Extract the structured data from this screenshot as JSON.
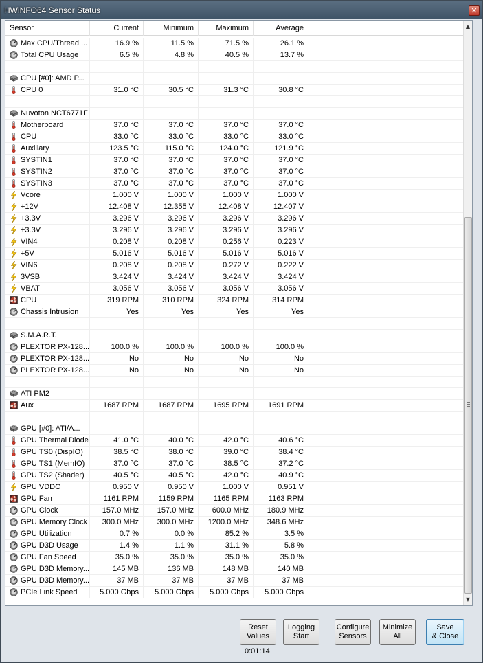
{
  "window": {
    "title": "HWiNFO64 Sensor Status",
    "close": "✕"
  },
  "columns": {
    "sensor": "Sensor",
    "current": "Current",
    "minimum": "Minimum",
    "maximum": "Maximum",
    "average": "Average"
  },
  "rows": [
    {
      "icon": "gauge",
      "name": "Max CPU/Thread ...",
      "cur": "16.9 %",
      "min": "11.5 %",
      "max": "71.5 %",
      "avg": "26.1 %"
    },
    {
      "icon": "gauge",
      "name": "Total CPU Usage",
      "cur": "6.5 %",
      "min": "4.8 %",
      "max": "40.5 %",
      "avg": "13.7 %"
    },
    {
      "icon": "",
      "name": "",
      "cur": "",
      "min": "",
      "max": "",
      "avg": ""
    },
    {
      "icon": "chip",
      "name": "CPU [#0]: AMD P...",
      "cur": "",
      "min": "",
      "max": "",
      "avg": ""
    },
    {
      "icon": "therm",
      "name": "CPU 0",
      "cur": "31.0 °C",
      "min": "30.5 °C",
      "max": "31.3 °C",
      "avg": "30.8 °C"
    },
    {
      "icon": "",
      "name": "",
      "cur": "",
      "min": "",
      "max": "",
      "avg": ""
    },
    {
      "icon": "chip",
      "name": "Nuvoton NCT6771F",
      "cur": "",
      "min": "",
      "max": "",
      "avg": ""
    },
    {
      "icon": "therm",
      "name": "Motherboard",
      "cur": "37.0 °C",
      "min": "37.0 °C",
      "max": "37.0 °C",
      "avg": "37.0 °C"
    },
    {
      "icon": "therm",
      "name": "CPU",
      "cur": "33.0 °C",
      "min": "33.0 °C",
      "max": "33.0 °C",
      "avg": "33.0 °C"
    },
    {
      "icon": "therm",
      "name": "Auxiliary",
      "cur": "123.5 °C",
      "min": "115.0 °C",
      "max": "124.0 °C",
      "avg": "121.9 °C"
    },
    {
      "icon": "therm",
      "name": "SYSTIN1",
      "cur": "37.0 °C",
      "min": "37.0 °C",
      "max": "37.0 °C",
      "avg": "37.0 °C"
    },
    {
      "icon": "therm",
      "name": "SYSTIN2",
      "cur": "37.0 °C",
      "min": "37.0 °C",
      "max": "37.0 °C",
      "avg": "37.0 °C"
    },
    {
      "icon": "therm",
      "name": "SYSTIN3",
      "cur": "37.0 °C",
      "min": "37.0 °C",
      "max": "37.0 °C",
      "avg": "37.0 °C"
    },
    {
      "icon": "bolt",
      "name": "Vcore",
      "cur": "1.000 V",
      "min": "1.000 V",
      "max": "1.000 V",
      "avg": "1.000 V"
    },
    {
      "icon": "bolt",
      "name": "+12V",
      "cur": "12.408 V",
      "min": "12.355 V",
      "max": "12.408 V",
      "avg": "12.407 V"
    },
    {
      "icon": "bolt",
      "name": "+3.3V",
      "cur": "3.296 V",
      "min": "3.296 V",
      "max": "3.296 V",
      "avg": "3.296 V"
    },
    {
      "icon": "bolt",
      "name": "+3.3V",
      "cur": "3.296 V",
      "min": "3.296 V",
      "max": "3.296 V",
      "avg": "3.296 V"
    },
    {
      "icon": "bolt",
      "name": "VIN4",
      "cur": "0.208 V",
      "min": "0.208 V",
      "max": "0.256 V",
      "avg": "0.223 V"
    },
    {
      "icon": "bolt",
      "name": "+5V",
      "cur": "5.016 V",
      "min": "5.016 V",
      "max": "5.016 V",
      "avg": "5.016 V"
    },
    {
      "icon": "bolt",
      "name": "VIN6",
      "cur": "0.208 V",
      "min": "0.208 V",
      "max": "0.272 V",
      "avg": "0.222 V"
    },
    {
      "icon": "bolt",
      "name": "3VSB",
      "cur": "3.424 V",
      "min": "3.424 V",
      "max": "3.424 V",
      "avg": "3.424 V"
    },
    {
      "icon": "bolt",
      "name": "VBAT",
      "cur": "3.056 V",
      "min": "3.056 V",
      "max": "3.056 V",
      "avg": "3.056 V"
    },
    {
      "icon": "fan",
      "name": "CPU",
      "cur": "319 RPM",
      "min": "310 RPM",
      "max": "324 RPM",
      "avg": "314 RPM"
    },
    {
      "icon": "gauge",
      "name": "Chassis Intrusion",
      "cur": "Yes",
      "min": "Yes",
      "max": "Yes",
      "avg": "Yes"
    },
    {
      "icon": "",
      "name": "",
      "cur": "",
      "min": "",
      "max": "",
      "avg": ""
    },
    {
      "icon": "chip",
      "name": "S.M.A.R.T.",
      "cur": "",
      "min": "",
      "max": "",
      "avg": ""
    },
    {
      "icon": "gauge",
      "name": "PLEXTOR PX-128...",
      "cur": "100.0 %",
      "min": "100.0 %",
      "max": "100.0 %",
      "avg": "100.0 %"
    },
    {
      "icon": "gauge",
      "name": "PLEXTOR PX-128...",
      "cur": "No",
      "min": "No",
      "max": "No",
      "avg": "No"
    },
    {
      "icon": "gauge",
      "name": "PLEXTOR PX-128...",
      "cur": "No",
      "min": "No",
      "max": "No",
      "avg": "No"
    },
    {
      "icon": "",
      "name": "",
      "cur": "",
      "min": "",
      "max": "",
      "avg": ""
    },
    {
      "icon": "chip",
      "name": "ATI PM2",
      "cur": "",
      "min": "",
      "max": "",
      "avg": ""
    },
    {
      "icon": "fan",
      "name": "Aux",
      "cur": "1687 RPM",
      "min": "1687 RPM",
      "max": "1695 RPM",
      "avg": "1691 RPM"
    },
    {
      "icon": "",
      "name": "",
      "cur": "",
      "min": "",
      "max": "",
      "avg": ""
    },
    {
      "icon": "chip",
      "name": "GPU [#0]: ATI/A...",
      "cur": "",
      "min": "",
      "max": "",
      "avg": ""
    },
    {
      "icon": "therm",
      "name": "GPU Thermal Diode",
      "cur": "41.0 °C",
      "min": "40.0 °C",
      "max": "42.0 °C",
      "avg": "40.6 °C"
    },
    {
      "icon": "therm",
      "name": "GPU TS0 (DispIO)",
      "cur": "38.5 °C",
      "min": "38.0 °C",
      "max": "39.0 °C",
      "avg": "38.4 °C"
    },
    {
      "icon": "therm",
      "name": "GPU TS1 (MemIO)",
      "cur": "37.0 °C",
      "min": "37.0 °C",
      "max": "38.5 °C",
      "avg": "37.2 °C"
    },
    {
      "icon": "therm",
      "name": "GPU TS2 (Shader)",
      "cur": "40.5 °C",
      "min": "40.5 °C",
      "max": "42.0 °C",
      "avg": "40.9 °C"
    },
    {
      "icon": "bolt",
      "name": "GPU VDDC",
      "cur": "0.950 V",
      "min": "0.950 V",
      "max": "1.000 V",
      "avg": "0.951 V"
    },
    {
      "icon": "fan",
      "name": "GPU Fan",
      "cur": "1161 RPM",
      "min": "1159 RPM",
      "max": "1165 RPM",
      "avg": "1163 RPM"
    },
    {
      "icon": "gauge",
      "name": "GPU Clock",
      "cur": "157.0 MHz",
      "min": "157.0 MHz",
      "max": "600.0 MHz",
      "avg": "180.9 MHz"
    },
    {
      "icon": "gauge",
      "name": "GPU Memory Clock",
      "cur": "300.0 MHz",
      "min": "300.0 MHz",
      "max": "1200.0 MHz",
      "avg": "348.6 MHz"
    },
    {
      "icon": "gauge",
      "name": "GPU Utilization",
      "cur": "0.7 %",
      "min": "0.0 %",
      "max": "85.2 %",
      "avg": "3.5 %"
    },
    {
      "icon": "gauge",
      "name": "GPU D3D Usage",
      "cur": "1.4 %",
      "min": "1.1 %",
      "max": "31.1 %",
      "avg": "5.8 %"
    },
    {
      "icon": "gauge",
      "name": "GPU Fan Speed",
      "cur": "35.0 %",
      "min": "35.0 %",
      "max": "35.0 %",
      "avg": "35.0 %"
    },
    {
      "icon": "gauge",
      "name": "GPU D3D Memory...",
      "cur": "145 MB",
      "min": "136 MB",
      "max": "148 MB",
      "avg": "140 MB"
    },
    {
      "icon": "gauge",
      "name": "GPU D3D Memory...",
      "cur": "37 MB",
      "min": "37 MB",
      "max": "37 MB",
      "avg": "37 MB"
    },
    {
      "icon": "gauge",
      "name": "PCIe Link Speed",
      "cur": "5.000 Gbps",
      "min": "5.000 Gbps",
      "max": "5.000 Gbps",
      "avg": "5.000 Gbps"
    }
  ],
  "buttons": {
    "reset": {
      "l1": "Reset",
      "l2": "Values"
    },
    "logging": {
      "l1": "Logging",
      "l2": "Start"
    },
    "configure": {
      "l1": "Configure",
      "l2": "Sensors"
    },
    "minimize": {
      "l1": "Minimize",
      "l2": "All"
    },
    "save": {
      "l1": "Save",
      "l2": "& Close"
    }
  },
  "timer": "0:01:14",
  "scrollbar": {
    "up": "▲",
    "down": "▼"
  }
}
